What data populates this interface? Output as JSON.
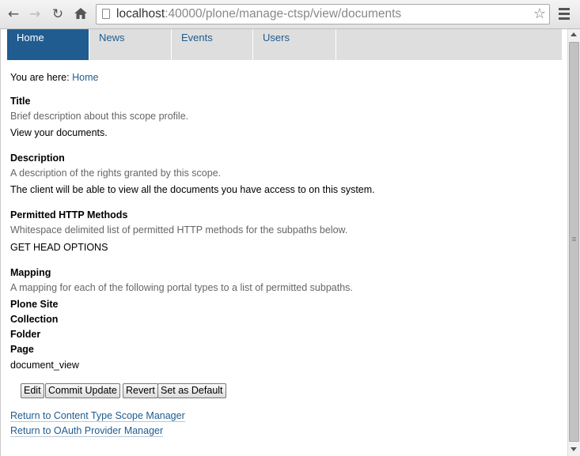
{
  "browser": {
    "url_host": "localhost",
    "url_rest": ":40000/plone/manage-ctsp/view/documents"
  },
  "tabs": [
    {
      "label": "Home",
      "selected": true
    },
    {
      "label": "News",
      "selected": false
    },
    {
      "label": "Events",
      "selected": false
    },
    {
      "label": "Users",
      "selected": false
    }
  ],
  "breadcrumb": {
    "prefix": "You are here:",
    "home": "Home"
  },
  "fields": {
    "title": {
      "label": "Title",
      "help": "Brief description about this scope profile.",
      "value": "View your documents."
    },
    "description": {
      "label": "Description",
      "help": "A description of the rights granted by this scope.",
      "value": "The client will be able to view all the documents you have access to on this system."
    },
    "methods": {
      "label": "Permitted HTTP Methods",
      "help": "Whitespace delimited list of permitted HTTP methods for the subpaths below.",
      "value": "GET HEAD OPTIONS"
    },
    "mapping": {
      "label": "Mapping",
      "help": "A mapping for each of the following portal types to a list of permitted subpaths.",
      "types": [
        "Plone Site",
        "Collection",
        "Folder",
        "Page"
      ],
      "page_value": "document_view"
    }
  },
  "buttons": {
    "edit": "Edit",
    "commit": "Commit Update",
    "revert": "Revert",
    "default": "Set as Default"
  },
  "links": {
    "scope_manager": "Return to Content Type Scope Manager",
    "provider_manager": "Return to OAuth Provider Manager"
  },
  "colors": {
    "accent": "#205c90",
    "tab_bg": "#dedede"
  }
}
